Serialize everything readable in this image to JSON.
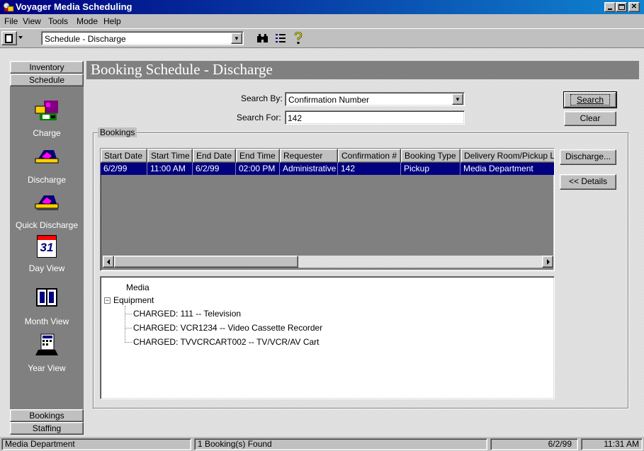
{
  "window": {
    "title": "Voyager Media Scheduling"
  },
  "menu": [
    "File",
    "View",
    "Tools",
    "Mode",
    "Help"
  ],
  "toolbar": {
    "view_combo": "Schedule - Discharge"
  },
  "nav": {
    "top_buttons": [
      "Inventory",
      "Schedule"
    ],
    "icons": [
      {
        "label": "Charge",
        "icon": "charge-icon"
      },
      {
        "label": "Discharge",
        "icon": "discharge-icon"
      },
      {
        "label": "Quick Discharge",
        "icon": "quick-discharge-icon"
      },
      {
        "label": "Day View",
        "icon": "calendar-day-icon"
      },
      {
        "label": "Month View",
        "icon": "calendar-month-icon"
      },
      {
        "label": "Year View",
        "icon": "calendar-year-icon"
      }
    ],
    "calendar_day_number": "31",
    "bottom_buttons": [
      "Bookings",
      "Staffing"
    ]
  },
  "page": {
    "title": "Booking Schedule - Discharge",
    "search_by_label": "Search By:",
    "search_by_value": "Confirmation Number",
    "search_for_label": "Search For:",
    "search_for_value": "142",
    "search_button": "Search",
    "clear_button": "Clear",
    "bookings_label": "Bookings",
    "discharge_button": "Discharge...",
    "details_button": "<< Details"
  },
  "grid": {
    "columns": [
      "Start Date",
      "Start Time",
      "End Date",
      "End Time",
      "Requester",
      "Confirmation #",
      "Booking Type",
      "Delivery Room/Pickup L"
    ],
    "rows": [
      [
        "6/2/99",
        "11:00 AM",
        "6/2/99",
        "02:00 PM",
        "Administrative",
        "142",
        "Pickup",
        "Media Department"
      ]
    ]
  },
  "tree": {
    "root": "Media",
    "group": "Equipment",
    "items": [
      "CHARGED:  111 -- Television",
      "CHARGED:  VCR1234 -- Video Cassette Recorder",
      "CHARGED:  TVVCRCART002 -- TV/VCR/AV Cart"
    ]
  },
  "status": {
    "department": "Media Department",
    "found": "1 Booking(s) Found",
    "date": "6/2/99",
    "time": "11:31 AM"
  },
  "colors": {
    "titlebar": "#000080",
    "selection": "#000080",
    "face": "#c0c0c0",
    "shadow": "#808080"
  }
}
